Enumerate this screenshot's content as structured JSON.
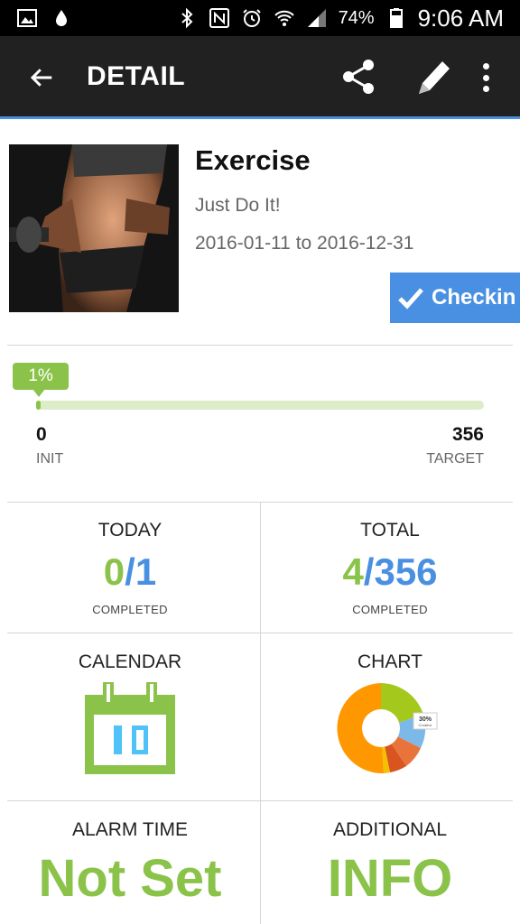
{
  "status_bar": {
    "battery": "74%",
    "time": "9:06 AM"
  },
  "app_bar": {
    "title": "DETAIL"
  },
  "goal": {
    "title": "Exercise",
    "slogan": "Just Do It!",
    "date_range": "2016-01-11 to 2016-12-31",
    "checkin_label": "Checkin"
  },
  "progress": {
    "percent_label": "1%",
    "fraction": 0.011,
    "init_value": "0",
    "init_label": "INIT",
    "target_value": "356",
    "target_label": "TARGET"
  },
  "today": {
    "label": "TODAY",
    "done": "0",
    "total": "/1",
    "caption": "COMPLETED"
  },
  "total": {
    "label": "TOTAL",
    "done": "4",
    "total": "/356",
    "caption": "COMPLETED"
  },
  "calendar": {
    "label": "CALENDAR",
    "icon": "calendar-icon"
  },
  "chart": {
    "label": "CHART",
    "icon": "pie-chart-icon",
    "tooltip_pct": "30%",
    "tooltip_label": "Creative"
  },
  "alarm": {
    "label": "ALARM TIME",
    "value": "Not Set"
  },
  "additional": {
    "label": "ADDITIONAL",
    "value": "INFO"
  },
  "colors": {
    "accent_green": "#8bc34a",
    "accent_blue": "#4a90e2",
    "app_bar": "#212121"
  }
}
